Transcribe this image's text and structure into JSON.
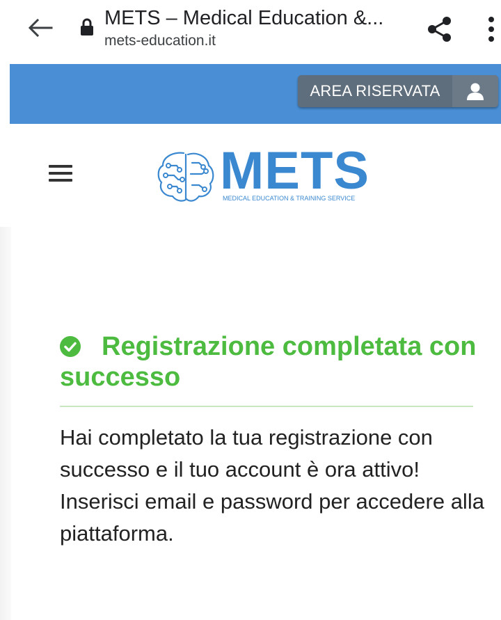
{
  "browser": {
    "tab_title": "METS – Medical Education &...",
    "url": "mets-education.it",
    "back_icon": "arrow-left-icon",
    "lock_icon": "lock-icon",
    "share_icon": "share-icon",
    "menu_icon": "more-vert-icon"
  },
  "topbar": {
    "area_button_label": "AREA RISERVATA",
    "user_icon": "user-icon",
    "color": "#4a8fd6"
  },
  "header": {
    "menu_icon": "hamburger-icon",
    "logo_brand": "METS",
    "logo_tagline": "MEDICAL EDUCATION & TRAINING SERVICE",
    "logo_icon": "brain-circuit-icon",
    "brand_color": "#3a88d0"
  },
  "content": {
    "success_icon": "check-circle-icon",
    "success_title": "Registrazione completata con successo",
    "success_color": "#4cbb3f",
    "message": "Hai completato la tua registrazione con successo e il tuo account è ora attivo! Inserisci email e password per accedere alla piattaforma."
  }
}
